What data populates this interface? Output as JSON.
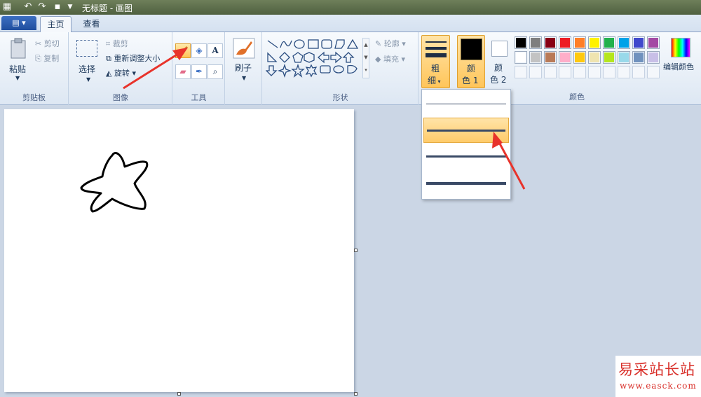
{
  "window": {
    "title": "无标题 - 画图"
  },
  "tabs": [
    {
      "label": "主页"
    },
    {
      "label": "查看"
    }
  ],
  "clipboard": {
    "paste": "粘贴",
    "cut": "剪切",
    "copy": "复制",
    "group": "剪贴板"
  },
  "image": {
    "select": "选择",
    "crop": "裁剪",
    "resize": "重新调整大小",
    "rotate": "旋转",
    "group": "图像"
  },
  "tools": {
    "group": "工具"
  },
  "brush": {
    "label": "刷子"
  },
  "shapes": {
    "outline": "轮廓",
    "fill": "填充",
    "group": "形状"
  },
  "size": {
    "label_top": "粗",
    "label_bottom": "细"
  },
  "color1": {
    "label_top": "颜",
    "label_bottom": "色 1"
  },
  "color2": {
    "label_top": "颜",
    "label_bottom": "色 2"
  },
  "colors": {
    "group": "颜色",
    "edit": "编辑颜色",
    "row1": [
      "#000000",
      "#7f7f7f",
      "#880015",
      "#ed1c24",
      "#ff7f27",
      "#fff200",
      "#22b14c",
      "#00a2e8",
      "#3f48cc",
      "#a349a4"
    ],
    "row2": [
      "#ffffff",
      "#c3c3c3",
      "#b97a57",
      "#ffaec9",
      "#ffc90e",
      "#efe4b0",
      "#b5e61d",
      "#99d9ea",
      "#7092be",
      "#c8bfe7"
    ]
  },
  "watermark": {
    "line1": "易采站长站",
    "line2": "www.easck.com"
  }
}
